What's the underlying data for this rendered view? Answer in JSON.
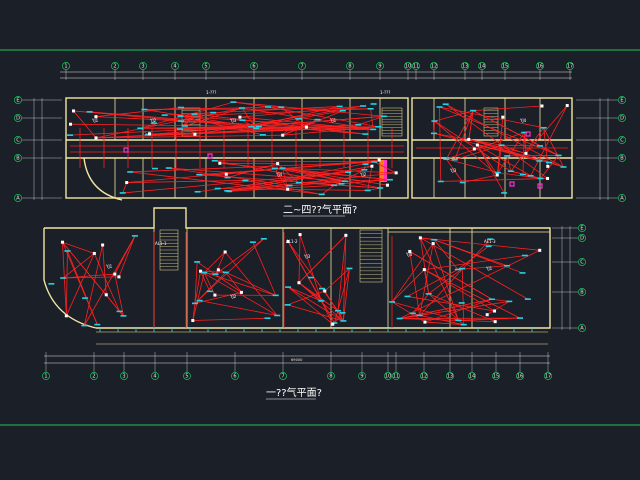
{
  "drawing": {
    "colors": {
      "background": "#1b1f27",
      "wall": "#f2e6a0",
      "wiring": "#ff2020",
      "fixture": "#22d3e6",
      "frame": "#17c45a",
      "dimension": "#e6e6e6",
      "magenta": "#ff33cc",
      "text": "#ffffff"
    },
    "plans": [
      {
        "id": "upper",
        "title": "二~四??气平面?"
      },
      {
        "id": "lower",
        "title": "一??气平面?"
      }
    ],
    "upper_axes": [
      "1",
      "2",
      "3",
      "4",
      "5",
      "6",
      "7",
      "8",
      "9",
      "10",
      "11",
      "12",
      "13",
      "14",
      "15",
      "16",
      "17"
    ],
    "lower_axes": [
      "1",
      "2",
      "3",
      "4",
      "5",
      "6",
      "7",
      "8",
      "9",
      "10",
      "11",
      "12",
      "13",
      "14",
      "15",
      "16",
      "17",
      "18"
    ],
    "left_axes": [
      "E",
      "D",
      "C",
      "B",
      "A"
    ],
    "right_axes": [
      "E",
      "D",
      "C",
      "B",
      "A"
    ],
    "total_dimension": "69000",
    "panel_labels": [
      "1-???",
      "1-???",
      "AL1-1",
      "AL1-2",
      "AL1-3"
    ],
    "room_labels": [
      "YJ1",
      "YJ2",
      "YJ3",
      "YJ4"
    ]
  }
}
